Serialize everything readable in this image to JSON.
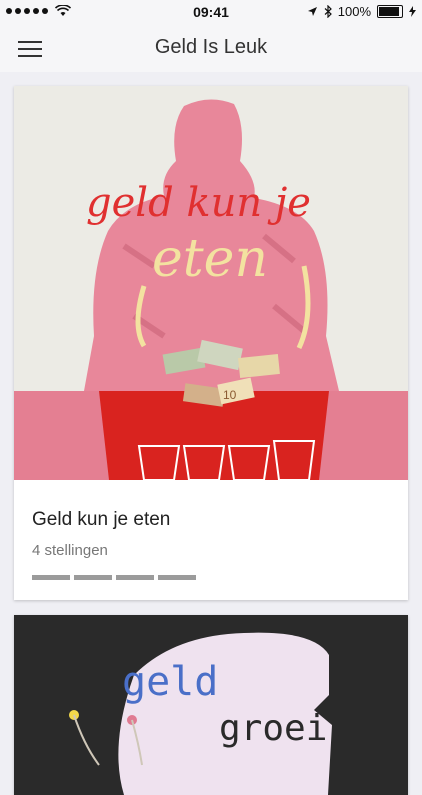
{
  "statusbar": {
    "time": "09:41",
    "battery": "100%",
    "battery_level": 1.0,
    "signal_bars": 5
  },
  "header": {
    "title": "Geld Is Leuk"
  },
  "cards": [
    {
      "title": "Geld kun je eten",
      "subtitle": "4 stellingen",
      "image_text_top": "geld kun je",
      "image_text_main": "eten",
      "progress_segments": 4,
      "bill_label": "10"
    },
    {
      "image_text_top": "geld",
      "image_text_main": "groeit"
    }
  ],
  "icons": {
    "menu": "hamburger-icon",
    "location": "location-arrow-icon",
    "bluetooth": "bluetooth-icon",
    "wifi": "wifi-icon",
    "battery": "battery-icon",
    "charging": "charging-bolt-icon"
  },
  "colors": {
    "accent_red": "#d92b2b",
    "pink_figure": "#e8879a",
    "yellow_text": "#f3e2a0",
    "progress_gray": "#9b9b9b"
  }
}
